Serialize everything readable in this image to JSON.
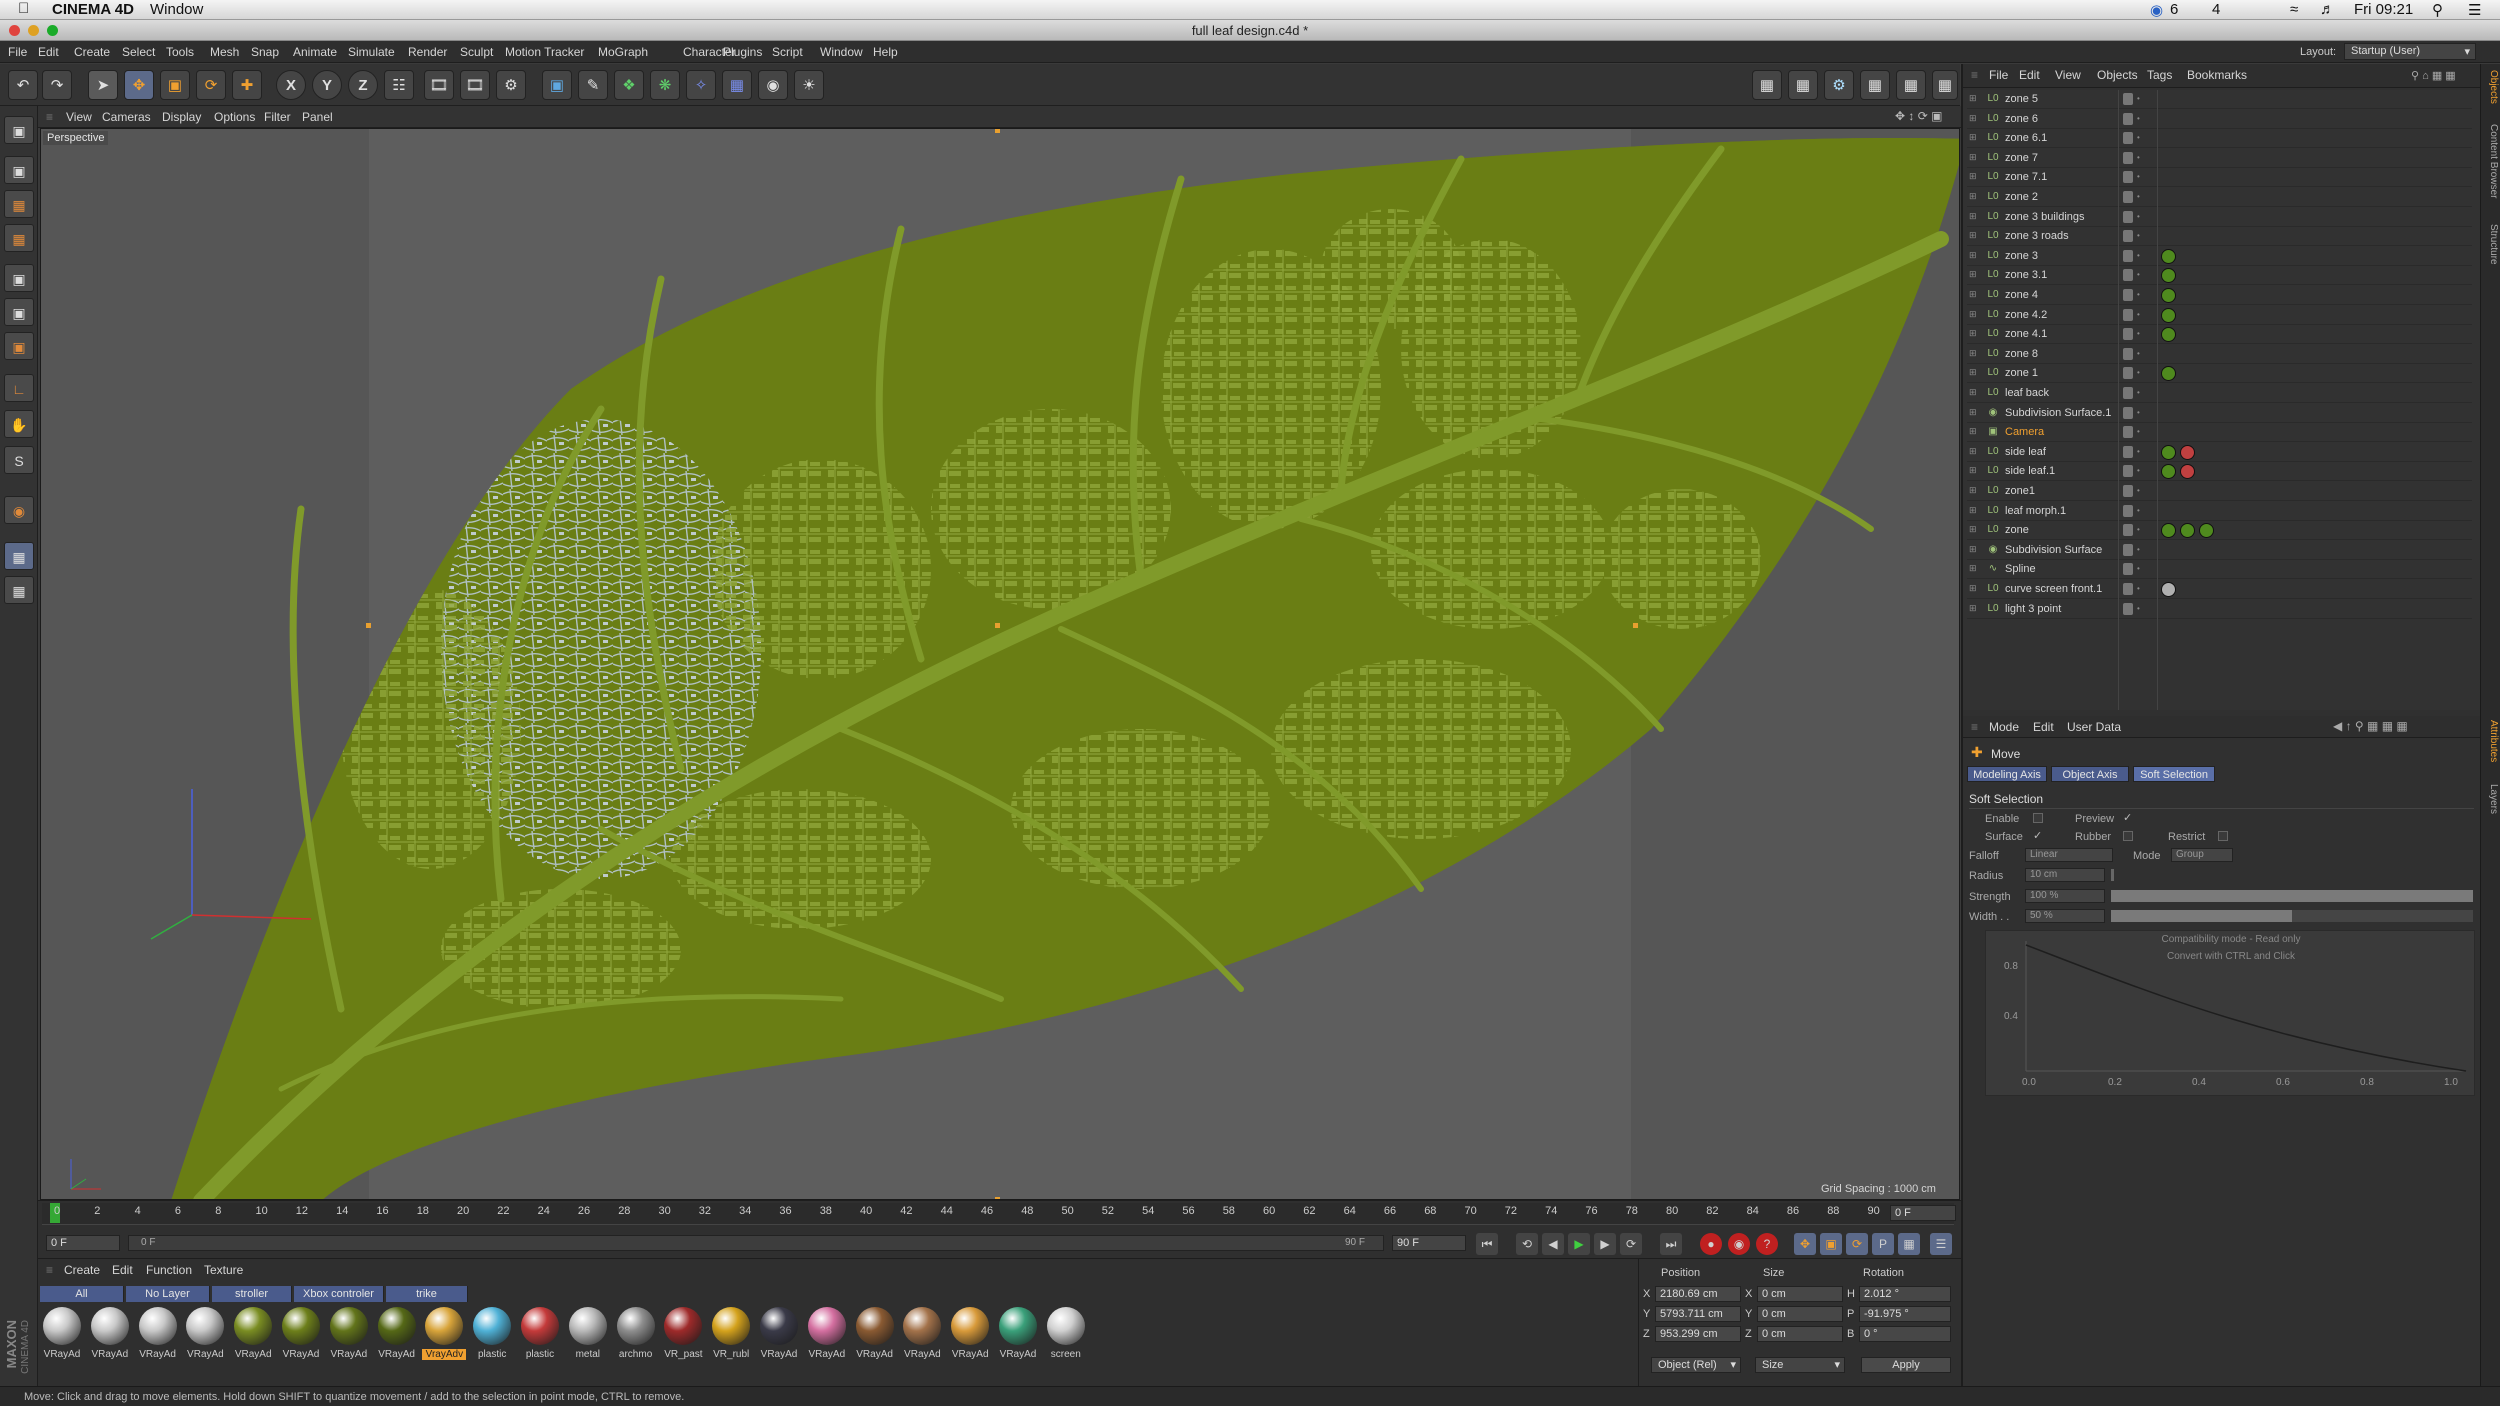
{
  "macbar": {
    "app_name": "CINEMA 4D",
    "menu_window": "Window",
    "clock": "Fri 09:21",
    "status_a": "6",
    "status_b": "4"
  },
  "window": {
    "title": "full leaf design.c4d *"
  },
  "main_menu": [
    "File",
    "Edit",
    "Create",
    "Select",
    "Tools",
    "Mesh",
    "Snap",
    "Animate",
    "Simulate",
    "Render",
    "Sculpt",
    "Motion Tracker",
    "MoGraph",
    "Character",
    "Plugins",
    "Script",
    "Window",
    "Help"
  ],
  "layout": {
    "label": "Layout:",
    "value": "Startup (User)"
  },
  "toolbar": {
    "axis_x": "X",
    "axis_y": "Y",
    "axis_z": "Z"
  },
  "viewport": {
    "menu": [
      "View",
      "Cameras",
      "Display",
      "Options",
      "Filter",
      "Panel"
    ],
    "label": "Perspective",
    "grid_spacing": "Grid Spacing : 1000 cm",
    "leaf_color": "#6a7e14",
    "vein_color": "#7f952a"
  },
  "object_manager": {
    "menu": [
      "File",
      "Edit",
      "View",
      "Objects",
      "Tags",
      "Bookmarks"
    ],
    "objects": [
      {
        "name": "zone 5",
        "tags": []
      },
      {
        "name": "zone 6",
        "tags": []
      },
      {
        "name": "zone 6.1",
        "tags": []
      },
      {
        "name": "zone 7",
        "tags": []
      },
      {
        "name": "zone 7.1",
        "tags": []
      },
      {
        "name": "zone 2",
        "tags": []
      },
      {
        "name": "zone 3 buildings",
        "tags": []
      },
      {
        "name": "zone 3 roads",
        "tags": []
      },
      {
        "name": "zone 3",
        "tags": [
          "green"
        ]
      },
      {
        "name": "zone 3.1",
        "tags": [
          "green"
        ]
      },
      {
        "name": "zone 4",
        "tags": [
          "green"
        ]
      },
      {
        "name": "zone 4.2",
        "tags": [
          "green"
        ]
      },
      {
        "name": "zone 4.1",
        "tags": [
          "green"
        ]
      },
      {
        "name": "zone 8",
        "tags": []
      },
      {
        "name": "zone 1",
        "tags": [
          "green"
        ]
      },
      {
        "name": "leaf back",
        "tags": []
      },
      {
        "name": "Subdivision Surface.1",
        "tags": []
      },
      {
        "name": "Camera",
        "tags": []
      },
      {
        "name": "side leaf",
        "tags": [
          "green",
          "red"
        ]
      },
      {
        "name": "side leaf.1",
        "tags": [
          "green",
          "red"
        ]
      },
      {
        "name": "zone1",
        "tags": []
      },
      {
        "name": "leaf morph.1",
        "tags": []
      },
      {
        "name": "zone",
        "tags": [
          "green",
          "green",
          "green"
        ]
      },
      {
        "name": "Subdivision Surface",
        "tags": []
      },
      {
        "name": "Spline",
        "tags": []
      },
      {
        "name": "curve screen front.1",
        "tags": [
          "grey"
        ]
      },
      {
        "name": "light 3 point",
        "tags": []
      }
    ]
  },
  "attributes": {
    "menu": [
      "Mode",
      "Edit",
      "User Data"
    ],
    "tool_name": "Move",
    "tabs": [
      "Modeling Axis",
      "Object Axis",
      "Soft Selection"
    ],
    "active_tab": "Soft Selection",
    "section_title": "Soft Selection",
    "enable_label": "Enable",
    "preview_label": "Preview",
    "surface_label": "Surface",
    "rubber_label": "Rubber",
    "restrict_label": "Restrict",
    "falloff_label": "Falloff",
    "falloff_value": "Linear",
    "mode_label": "Mode",
    "mode_value": "Group",
    "radius_label": "Radius",
    "radius_value": "10 cm",
    "strength_label": "Strength",
    "strength_value": "100 %",
    "width_label": "Width . .",
    "width_value": "50 %",
    "compat_line1": "Compatibility mode - Read only",
    "compat_line2": "Convert with CTRL and Click",
    "graph_y_labels": [
      "0.8",
      "0.4",
      "0.0"
    ],
    "graph_x_labels": [
      "0.2",
      "0.4",
      "0.6",
      "0.8",
      "1.0"
    ]
  },
  "timeline": {
    "ticks": [
      "0",
      "2",
      "4",
      "6",
      "8",
      "10",
      "12",
      "14",
      "16",
      "18",
      "20",
      "22",
      "24",
      "26",
      "28",
      "30",
      "32",
      "34",
      "36",
      "38",
      "40",
      "42",
      "44",
      "46",
      "48",
      "50",
      "52",
      "54",
      "56",
      "58",
      "60",
      "62",
      "64",
      "66",
      "68",
      "70",
      "72",
      "74",
      "76",
      "78",
      "80",
      "82",
      "84",
      "86",
      "88",
      "90"
    ],
    "current_frame": "0 F",
    "start_frame": "0 F",
    "range_start": "0 F",
    "range_end": "90 F",
    "end_frame": "90 F",
    "end_field": "0 F"
  },
  "materials": {
    "menu": [
      "Create",
      "Edit",
      "Function",
      "Texture"
    ],
    "filters": [
      "All",
      "No Layer",
      "stroller",
      "Xbox controler",
      "trike"
    ],
    "items": [
      {
        "label": "VRayAd",
        "color": "#c8c8c8"
      },
      {
        "label": "VRayAd",
        "color": "#c8c8c8"
      },
      {
        "label": "VRayAd",
        "color": "#c8c8c8"
      },
      {
        "label": "VRayAd",
        "color": "#c8c8c8"
      },
      {
        "label": "VRayAd",
        "color": "#7a8d22"
      },
      {
        "label": "VRayAd",
        "color": "#6d7f1a"
      },
      {
        "label": "VRayAd",
        "color": "#62741a"
      },
      {
        "label": "VRayAd",
        "color": "#556816"
      },
      {
        "label": "VrayAdv",
        "color": "#d8a43a"
      },
      {
        "label": "plastic",
        "color": "#4fb1d6"
      },
      {
        "label": "plastic",
        "color": "#c43a3a"
      },
      {
        "label": "metal",
        "color": "#b9b9b9"
      },
      {
        "label": "archmo",
        "color": "#8e8e8e"
      },
      {
        "label": "VR_past",
        "color": "#9e2a2a"
      },
      {
        "label": "VR_rubl",
        "color": "#d4a21c"
      },
      {
        "label": "VRayAd",
        "color": "#3a3a48"
      },
      {
        "label": "VRayAd",
        "color": "#d46fa0"
      },
      {
        "label": "VRayAd",
        "color": "#8a5a32"
      },
      {
        "label": "VRayAd",
        "color": "#a3724a"
      },
      {
        "label": "VRayAd",
        "color": "#d89a3a"
      },
      {
        "label": "VRayAd",
        "color": "#3aa07a"
      },
      {
        "label": "screen",
        "color": "#d0d0d0"
      }
    ]
  },
  "coords": {
    "headers": [
      "Position",
      "Size",
      "Rotation"
    ],
    "rows": [
      {
        "axis": "X",
        "pos": "2180.69 cm",
        "size_axis": "X",
        "size": "0 cm",
        "rot_axis": "H",
        "rot": "2.012 °"
      },
      {
        "axis": "Y",
        "pos": "5793.711 cm",
        "size_axis": "Y",
        "size": "0 cm",
        "rot_axis": "P",
        "rot": "-91.975 °"
      },
      {
        "axis": "Z",
        "pos": "953.299 cm",
        "size_axis": "Z",
        "size": "0 cm",
        "rot_axis": "B",
        "rot": "0 °"
      }
    ],
    "mode_select": "Object (Rel)",
    "size_select": "Size",
    "apply_label": "Apply"
  },
  "status": {
    "text": "Move: Click and drag to move elements. Hold down SHIFT to quantize movement / add to the selection in point mode, CTRL to remove."
  },
  "brand": {
    "maxon": "MAXON",
    "c4d": "CINEMA 4D"
  },
  "right_tabs": {
    "objects": "Objects",
    "content": "Content Browser",
    "structure": "Structure",
    "attributes": "Attributes",
    "layers": "Layers"
  }
}
